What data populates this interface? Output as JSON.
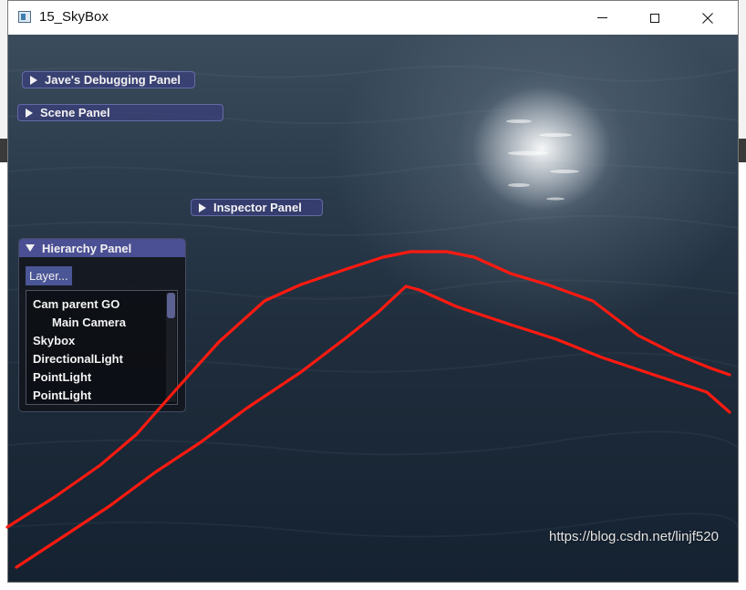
{
  "window": {
    "title": "15_SkyBox",
    "icon": "app-window-icon",
    "controls": [
      "minimize",
      "maximize",
      "close"
    ],
    "close_glyph": "✕"
  },
  "panels": {
    "debug": {
      "label": "Jave's Debugging Panel",
      "state": "collapsed"
    },
    "scene": {
      "label": "Scene Panel",
      "state": "collapsed"
    },
    "inspector": {
      "label": "Inspector Panel",
      "state": "collapsed"
    },
    "hierarchy": {
      "label": "Hierarchy Panel",
      "state": "expanded",
      "layer_button": "Layer...",
      "items": [
        {
          "label": "Cam parent GO"
        },
        {
          "label": "Main Camera"
        },
        {
          "label": "Skybox"
        },
        {
          "label": "DirectionalLight"
        },
        {
          "label": "PointLight"
        },
        {
          "label": "PointLight"
        }
      ]
    }
  },
  "annotation_color": "#ff1a10",
  "accent_colors": {
    "panel_title": "#4b4f93",
    "button": "#4b5696"
  },
  "watermark": "https://blog.csdn.net/linjf520"
}
